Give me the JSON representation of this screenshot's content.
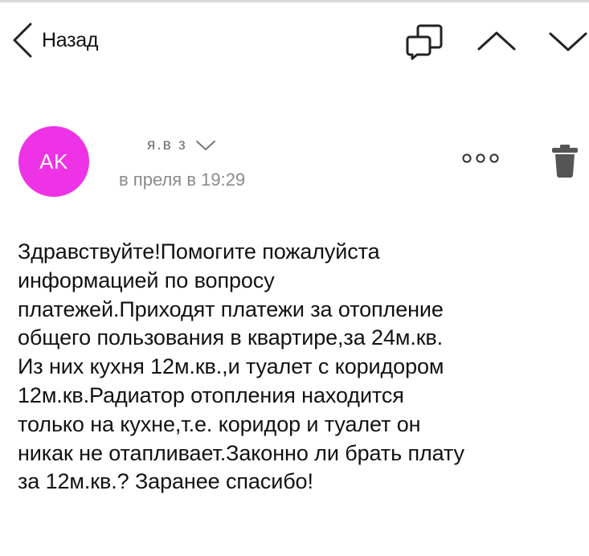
{
  "nav": {
    "back_label": "Назад",
    "icons": [
      "chevron-left-icon",
      "compose-reply-icon",
      "chevron-up-icon",
      "chevron-down-icon"
    ]
  },
  "message": {
    "avatar_initials": "AK",
    "avatar_color": "#ee33e6",
    "sender_display": "я.в      з",
    "date": "в преля в 19:29",
    "body": "Здравствуйте!Помогите пожалуйста\nинформацией по вопросу\nплатежей.Приходят платежи за отопление\nобщего пользования в квартире,за 24м.кв.\nИз них кухня 12м.кв.,и туалет с коридором\n12м.кв.Радиатор отопления находится\nтолько на кухне,т.е. коридор и туалет он\nникак не отапливает.Законно ли брать плату\nза 12м.кв.? Заранее спасибо!"
  },
  "colors": {
    "avatar": "#ee33e6",
    "text": "#121212",
    "secondary_text": "#8b8b8b",
    "icon": "#222222",
    "trash": "#555555"
  }
}
